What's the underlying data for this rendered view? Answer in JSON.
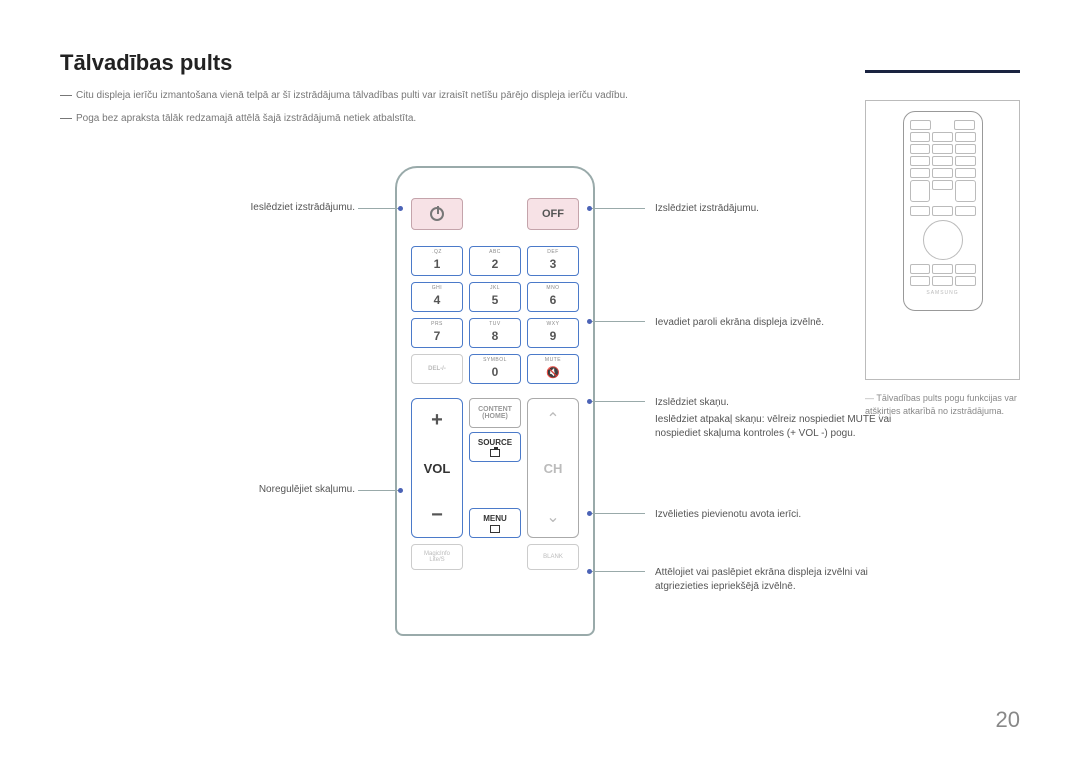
{
  "title": "Tālvadības pults",
  "note1": "Citu displeja ierīču izmantošana vienā telpā ar šī izstrādājuma tālvadības pulti var izraisīt netīšu pārējo displeja ierīču vadību.",
  "note2": "Poga bez apraksta tālāk redzamajā attēlā šajā izstrādājumā netiek atbalstīta.",
  "left": {
    "power_on": "Ieslēdziet izstrādājumu.",
    "volume": "Noregulējiet skaļumu."
  },
  "right": {
    "power_off": "Izslēdziet izstrādājumu.",
    "password": "Ievadiet paroli ekrāna displeja izvēlnē.",
    "mute": "Izslēdziet skaņu.",
    "mute2": "Ieslēdziet atpakaļ skaņu: vēlreiz nospiediet MUTE vai nospiediet skaļuma kontroles (+ VOL -) pogu.",
    "source": "Izvēlieties pievienotu avota ierīci.",
    "menu": "Attēlojiet vai paslēpiet ekrāna displeja izvēlni vai atgriezieties iepriekšējā izvēlnē."
  },
  "remote": {
    "off": "OFF",
    "keys": {
      "k1": {
        "n": "1",
        "s": ".QZ"
      },
      "k2": {
        "n": "2",
        "s": "ABC"
      },
      "k3": {
        "n": "3",
        "s": "DEF"
      },
      "k4": {
        "n": "4",
        "s": "GHI"
      },
      "k5": {
        "n": "5",
        "s": "JKL"
      },
      "k6": {
        "n": "6",
        "s": "MNO"
      },
      "k7": {
        "n": "7",
        "s": "PRS"
      },
      "k8": {
        "n": "8",
        "s": "TUV"
      },
      "k9": {
        "n": "9",
        "s": "WXY"
      },
      "k0": {
        "n": "0",
        "s": "SYMBOL"
      }
    },
    "del": "DEL-/-",
    "mute_label": "MUTE",
    "vol": "VOL",
    "ch": "CH",
    "content": "CONTENT",
    "home": "(HOME)",
    "source": "SOURCE",
    "menu": "MENU",
    "magic": "MagicInfo",
    "lite": "Lite/S",
    "blank": "BLANK"
  },
  "sidenote": "Tālvadības pults pogu funkcijas var atšķirties atkarībā no izstrādājuma.",
  "page": "20"
}
